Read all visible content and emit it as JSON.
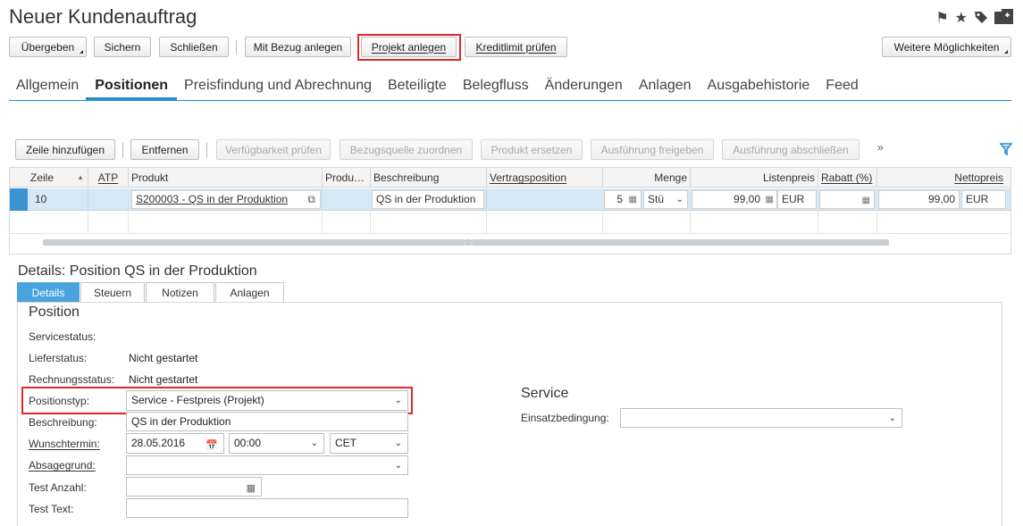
{
  "window": {
    "title": "Neuer Kundenauftrag"
  },
  "top_icons": [
    "flag-icon",
    "star-icon",
    "tag-icon",
    "new-document-icon"
  ],
  "toolbar": {
    "uebergeben": "Übergeben",
    "sichern": "Sichern",
    "schliessen": "Schließen",
    "mit_bezug": "Mit Bezug anlegen",
    "projekt_anlegen": "Projekt anlegen",
    "kreditlimit": "Kreditlimit prüfen",
    "weitere": "Weitere Möglichkeiten"
  },
  "tabs": [
    "Allgemein",
    "Positionen",
    "Preisfindung und Abrechnung",
    "Beteiligte",
    "Belegfluss",
    "Änderungen",
    "Anlagen",
    "Ausgabehistorie",
    "Feed"
  ],
  "active_tab": "Positionen",
  "items_toolbar": {
    "zeile_hinzufuegen": "Zeile hinzufügen",
    "entfernen": "Entfernen",
    "verfuegbarkeit": "Verfügbarkeit prüfen",
    "bezugsquelle": "Bezugsquelle zuordnen",
    "produkt_ersetzen": "Produkt ersetzen",
    "ausfuehrung_freigeben": "Ausführung freigeben",
    "ausfuehrung_abschliessen": "Ausführung abschließen",
    "more": "»"
  },
  "grid": {
    "headers": {
      "zeile": "Zeile",
      "atp": "ATP",
      "produkt": "Produkt",
      "produ": "Produ…",
      "beschreibung": "Beschreibung",
      "vertragsposition": "Vertragsposition",
      "menge": "Menge",
      "listenpreis": "Listenpreis",
      "rabatt": "Rabatt (%)",
      "nettopreis": "Nettopreis"
    },
    "row": {
      "zeile": "10",
      "produkt": "S200003 - QS in der Produktion",
      "beschreibung": "QS in der Produktion",
      "menge": "5",
      "einheit": "Stü",
      "listenpreis": "99,00",
      "listenpreis_waehrung": "EUR",
      "nettopreis": "99,00",
      "nettopreis_waehrung": "EUR"
    }
  },
  "details": {
    "title": "Details: Position QS in der Produktion",
    "tabs": [
      "Details",
      "Steuern",
      "Notizen",
      "Anlagen"
    ],
    "active_tab": "Details",
    "position": {
      "heading": "Position",
      "servicestatus_label": "Servicestatus:",
      "servicestatus_value": "",
      "lieferstatus_label": "Lieferstatus:",
      "lieferstatus_value": "Nicht gestartet",
      "rechnungsstatus_label": "Rechnungsstatus:",
      "rechnungsstatus_value": "Nicht gestartet",
      "positionstyp_label": "Positionstyp:",
      "positionstyp_value": "Service - Festpreis (Projekt)",
      "beschreibung_label": "Beschreibung:",
      "beschreibung_value": "QS in der Produktion",
      "wunschtermin_label": "Wunschtermin:",
      "wunschtermin_date": "28.05.2016",
      "wunschtermin_time": "00:00",
      "wunschtermin_tz": "CET",
      "absagegrund_label": "Absagegrund:",
      "absagegrund_value": "",
      "test_anzahl_label": "Test Anzahl:",
      "test_anzahl_value": "",
      "test_text_label": "Test Text:",
      "test_text_value": ""
    },
    "service": {
      "heading": "Service",
      "einsatzbedingung_label": "Einsatzbedingung:",
      "einsatzbedingung_value": ""
    }
  },
  "colors": {
    "accent": "#2b8bc6",
    "highlight": "#e3262b",
    "selected_row": "#d6e8f5",
    "active_detail_tab": "#4aa3df"
  }
}
